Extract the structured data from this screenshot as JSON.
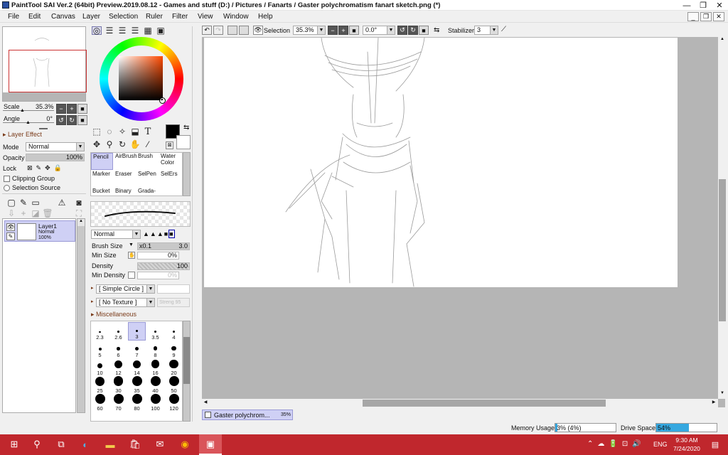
{
  "window": {
    "title": "PaintTool SAI Ver.2 (64bit) Preview.2019.08.12 - Games and stuff (D:) / Pictures / Fanarts / Gaster polychromatism fanart sketch.png (*)",
    "min_glyph": "—",
    "max_glyph": "❐",
    "close_glyph": "✕"
  },
  "menu": [
    "File",
    "Edit",
    "Canvas",
    "Layer",
    "Selection",
    "Ruler",
    "Filter",
    "View",
    "Window",
    "Help"
  ],
  "toolbar": {
    "selection_label": "Selection",
    "zoom": "35.3%",
    "rotation": "0.0°",
    "stabilizer_label": "Stabilizer",
    "stabilizer_value": "3"
  },
  "navigator": {
    "scale_label": "Scale",
    "scale_value": "35.3%",
    "angle_label": "Angle",
    "angle_value": "0°"
  },
  "layer_panel": {
    "effect_label": "Layer Effect",
    "mode_label": "Mode",
    "mode_value": "Normal",
    "opacity_label": "Opacity",
    "opacity_value": "100%",
    "lock_label": "Lock",
    "clipping_group": "Clipping Group",
    "selection_source": "Selection Source",
    "layers": [
      {
        "name": "Layer1",
        "mode": "Normal",
        "opacity": "100%"
      }
    ]
  },
  "tools": {
    "text_tool_glyph": "T",
    "brushes": [
      "Pencil",
      "AirBrush",
      "Brush",
      "Water Color",
      "Marker",
      "Eraser",
      "SelPen",
      "SelErs",
      "Bucket",
      "Binary",
      "Grada-"
    ]
  },
  "brush_settings": {
    "blend_mode": "Normal",
    "brush_size_label": "Brush Size",
    "brush_size_mult": "x0.1",
    "brush_size_value": "3.0",
    "min_size_label": "Min Size",
    "min_size_value": "0%",
    "density_label": "Density",
    "density_value": "100",
    "min_density_label": "Min Density",
    "min_density_value": "0%",
    "shape": "[ Simple Circle ]",
    "texture": "[ No Texture ]",
    "texture_strength": "Streng 95",
    "misc_label": "Miscellaneous",
    "sizes": [
      "2.3",
      "2.6",
      "3",
      "3.5",
      "4",
      "5",
      "6",
      "7",
      "8",
      "9",
      "10",
      "12",
      "14",
      "16",
      "20",
      "25",
      "30",
      "35",
      "40",
      "50",
      "60",
      "70",
      "80",
      "100",
      "120"
    ],
    "selected_size": "3"
  },
  "canvas_tab": {
    "name": "Gaster polychrom...",
    "zoom": "35%"
  },
  "status": {
    "memory_label": "Memory Usage",
    "memory_value": "3% (4%)",
    "memory_fraction": 0.03,
    "drive_label": "Drive Space",
    "drive_value": "54%",
    "drive_fraction": 0.54
  },
  "taskbar": {
    "lang": "ENG",
    "time": "9:30 AM",
    "date": "7/24/2020"
  },
  "colors": {
    "taskbar": "#c0272d",
    "canvas_bg": "#b5b5b5",
    "fore_color": "#000000",
    "selection_blue": "#cfd0f5"
  }
}
